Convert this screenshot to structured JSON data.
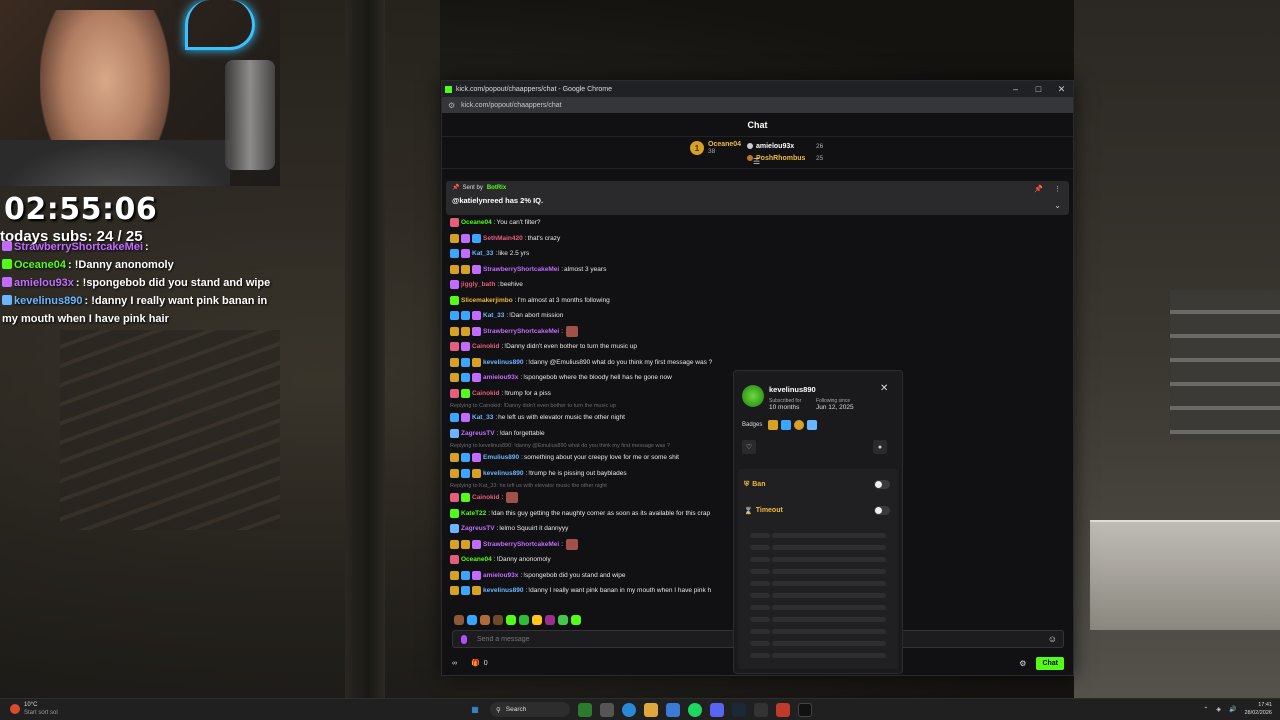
{
  "stream_overlay": {
    "timer": "02:55:06",
    "subs": "todays subs:  24 / 25",
    "chat": [
      {
        "user": "StrawberryShortcakeMei",
        "text": "",
        "color": "#c26bff"
      },
      {
        "user": "Oceane04",
        "text": "!Danny anonomoly",
        "color": "#53fc18"
      },
      {
        "user": "amielou93x",
        "text": "!spongebob did you stand and wipe",
        "color": "#c26bff"
      },
      {
        "user": "kevelinus890",
        "text": "!danny I really want pink banan in my mouth when I have pink hair",
        "color": "#6ab5ff"
      }
    ]
  },
  "browser": {
    "title": "kick.com/popout/chaappers/chat - Google Chrome",
    "url": "kick.com/popout/chaappers/chat",
    "min_icon": "minimize-icon",
    "max_icon": "maximize-icon",
    "close_icon": "close-icon"
  },
  "chat": {
    "header": "Chat",
    "leaderboard": {
      "first": {
        "rank": "1",
        "user": "Oceane04",
        "count": "38"
      },
      "others": [
        {
          "user": "amielou93x",
          "count": "26",
          "color": "#ffffff"
        },
        {
          "user": "PoshRhombus",
          "count": "25",
          "color": "#f0b83c"
        }
      ]
    },
    "pinned": {
      "sent_by_label": "Sent by",
      "bot": "BotRix",
      "message": "@katielynreed has 2% IQ."
    },
    "messages": [
      {
        "user": "Oceane04",
        "text": "You can't filter?",
        "color": "#53fc18",
        "badges": [
          "#e65c7b"
        ]
      },
      {
        "user": "SethMain420",
        "text": "that's crazy",
        "color": "#e65c7b",
        "badges": [
          "#d6a124",
          "#c26bff",
          "#3aa6ff"
        ]
      },
      {
        "user": "Kat_33",
        "text": "like 2.5 yrs",
        "color": "#6ab5ff",
        "badges": [
          "#3aa6ff",
          "#c26bff"
        ]
      },
      {
        "user": "StrawberryShortcakeMei",
        "text": "almost 3 years",
        "color": "#c26bff",
        "badges": [
          "#d6a124",
          "#d6a124",
          "#c26bff"
        ]
      },
      {
        "user": "jiggly_bath",
        "text": "beehive",
        "color": "#e65c7b",
        "badges": [
          "#c26bff"
        ]
      },
      {
        "user": "Slicemakerjimbo",
        "text": "I'm almost at 3 months following",
        "color": "#f0b83c",
        "badges": [
          "#53fc18"
        ]
      },
      {
        "user": "Kat_33",
        "text": "!Dan abort mission",
        "color": "#6ab5ff",
        "badges": [
          "#3aa6ff",
          "#3aa6ff",
          "#c26bff"
        ]
      },
      {
        "user": "StrawberryShortcakeMei",
        "text": "",
        "color": "#c26bff",
        "badges": [
          "#d6a124",
          "#d6a124",
          "#c26bff"
        ]
      },
      {
        "user": "Cainokid",
        "text": "!Danny didn't even bother to turn the music up",
        "color": "#e65c7b",
        "badges": [
          "#e65c7b",
          "#c26bff"
        ]
      },
      {
        "user": "kevelinus890",
        "text": "!danny @Emulius890 what do you think my first message was ?",
        "color": "#6ab5ff",
        "badges": [
          "#d6a124",
          "#3aa6ff",
          "#d6a124"
        ]
      },
      {
        "user": "amielou93x",
        "text": "!spongebob where the bloody hell has he gone now",
        "color": "#c26bff",
        "badges": [
          "#d6a124",
          "#3aa6ff",
          "#c26bff"
        ]
      },
      {
        "user": "Cainokid",
        "text": "!trump for a piss",
        "color": "#e65c7b",
        "badges": [
          "#e65c7b",
          "#53fc18"
        ]
      },
      {
        "reply_to": "Replying to Cainokid: !Danny didn't even bother to turn the music up"
      },
      {
        "user": "Kat_33",
        "text": "he left us with elevator music the other night",
        "color": "#6ab5ff",
        "badges": [
          "#3aa6ff",
          "#c26bff"
        ]
      },
      {
        "user": "ZagreusTV",
        "text": "!dan forgettable",
        "color": "#c26bff",
        "badges": [
          "#6ab5ff"
        ]
      },
      {
        "reply_to": "Replying to kevelinus890: !danny @Emulius890 what do you think my first message was ?"
      },
      {
        "user": "Emulius890",
        "text": "something about your creepy love for me or some shit",
        "color": "#6ab5ff",
        "badges": [
          "#d6a124",
          "#3aa6ff",
          "#c26bff"
        ]
      },
      {
        "user": "kevelinus890",
        "text": "!trump he is pissing out bayblades",
        "color": "#6ab5ff",
        "badges": [
          "#d6a124",
          "#3aa6ff",
          "#d6a124"
        ]
      },
      {
        "reply_to": "Replying to Kat_33: he left us with elevator music the other night"
      },
      {
        "user": "Cainokid",
        "text": "",
        "color": "#e65c7b",
        "badges": [
          "#e65c7b",
          "#53fc18"
        ]
      },
      {
        "user": "KateT22",
        "text": "!dan this guy getting the naughty corner as soon as its available for this crap",
        "color": "#53fc18",
        "badges": [
          "#53fc18"
        ]
      },
      {
        "user": "ZagreusTV",
        "text": "lelmo Squuirt it dannyyy",
        "color": "#c26bff",
        "badges": [
          "#6ab5ff"
        ]
      },
      {
        "user": "StrawberryShortcakeMei",
        "text": "",
        "color": "#c26bff",
        "badges": [
          "#d6a124",
          "#d6a124",
          "#c26bff"
        ]
      },
      {
        "user": "Oceane04",
        "text": "!Danny anonomoly",
        "color": "#53fc18",
        "badges": [
          "#e65c7b"
        ]
      },
      {
        "user": "amielou93x",
        "text": "!spongebob did you stand and wipe",
        "color": "#c26bff",
        "badges": [
          "#d6a124",
          "#3aa6ff",
          "#c26bff"
        ]
      },
      {
        "user": "kevelinus890",
        "text": "!danny I really want pink banan in my mouth when I have pink h",
        "color": "#6ab5ff",
        "badges": [
          "#d6a124",
          "#3aa6ff",
          "#d6a124"
        ]
      }
    ],
    "input_placeholder": "Send a message",
    "points": "0",
    "chat_button": "Chat"
  },
  "user_card": {
    "username": "kevelinus890",
    "subscribed_label": "Subscribed for",
    "subscribed_value": "10 months",
    "following_label": "Following since",
    "following_value": "Jun 12, 2025",
    "badges_label": "Badges",
    "ban_label": "Ban",
    "timeout_label": "Timeout"
  },
  "taskbar": {
    "weather_temp": "10°C",
    "weather_desc": "Start sort sol",
    "search_label": "Search",
    "time": "17:41",
    "date": "28/02/2026"
  }
}
